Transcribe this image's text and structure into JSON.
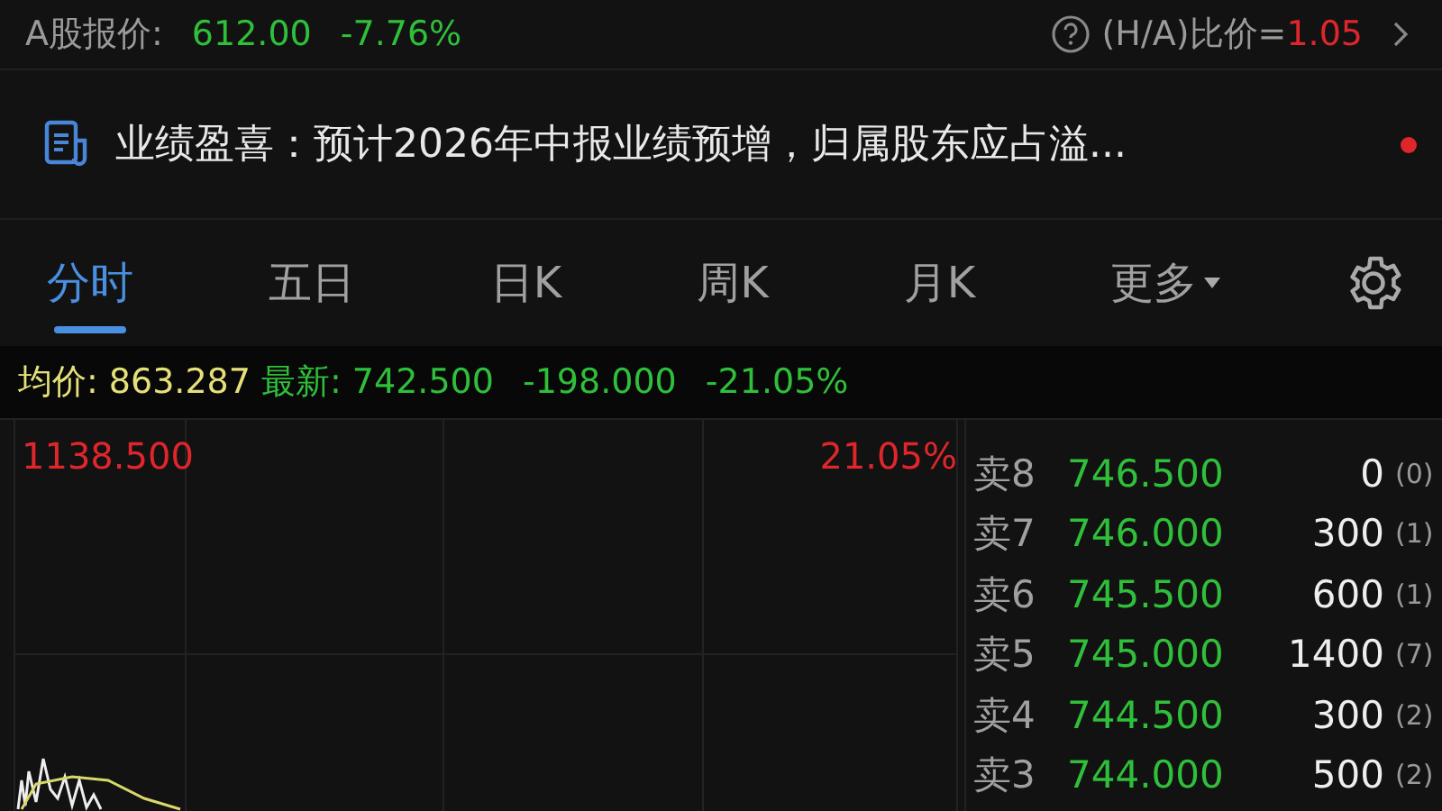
{
  "quote": {
    "label": "A股报价:",
    "price": "612.00",
    "change": "-7.76%",
    "ratio_label": "(H/A)比价=",
    "ratio": "1.05"
  },
  "notice": {
    "text": "业绩盈喜：预计2026年中报业绩预增，归属股东应占溢...",
    "unread": true
  },
  "tabs": [
    {
      "label": "分时",
      "selected": true
    },
    {
      "label": "五日",
      "selected": false
    },
    {
      "label": "日K",
      "selected": false
    },
    {
      "label": "周K",
      "selected": false
    },
    {
      "label": "月K",
      "selected": false
    },
    {
      "label": "更多",
      "selected": false,
      "dropdown": true
    }
  ],
  "info": {
    "avg_label": "均价:",
    "avg": "863.287",
    "last_label": "最新:",
    "last": "742.500",
    "change": "-198.000",
    "change_pct": "-21.05%"
  },
  "chart": {
    "top_price": "1138.500",
    "top_pct": "21.05%"
  },
  "order_book": [
    {
      "side": "卖8",
      "price": "746.500",
      "volume": "0",
      "count": "(0)"
    },
    {
      "side": "卖7",
      "price": "746.000",
      "volume": "300",
      "count": "(1)"
    },
    {
      "side": "卖6",
      "price": "745.500",
      "volume": "600",
      "count": "(1)"
    },
    {
      "side": "卖5",
      "price": "745.000",
      "volume": "1400",
      "count": "(7)"
    },
    {
      "side": "卖4",
      "price": "744.500",
      "volume": "300",
      "count": "(2)"
    },
    {
      "side": "卖3",
      "price": "744.000",
      "volume": "500",
      "count": "(2)"
    }
  ]
}
